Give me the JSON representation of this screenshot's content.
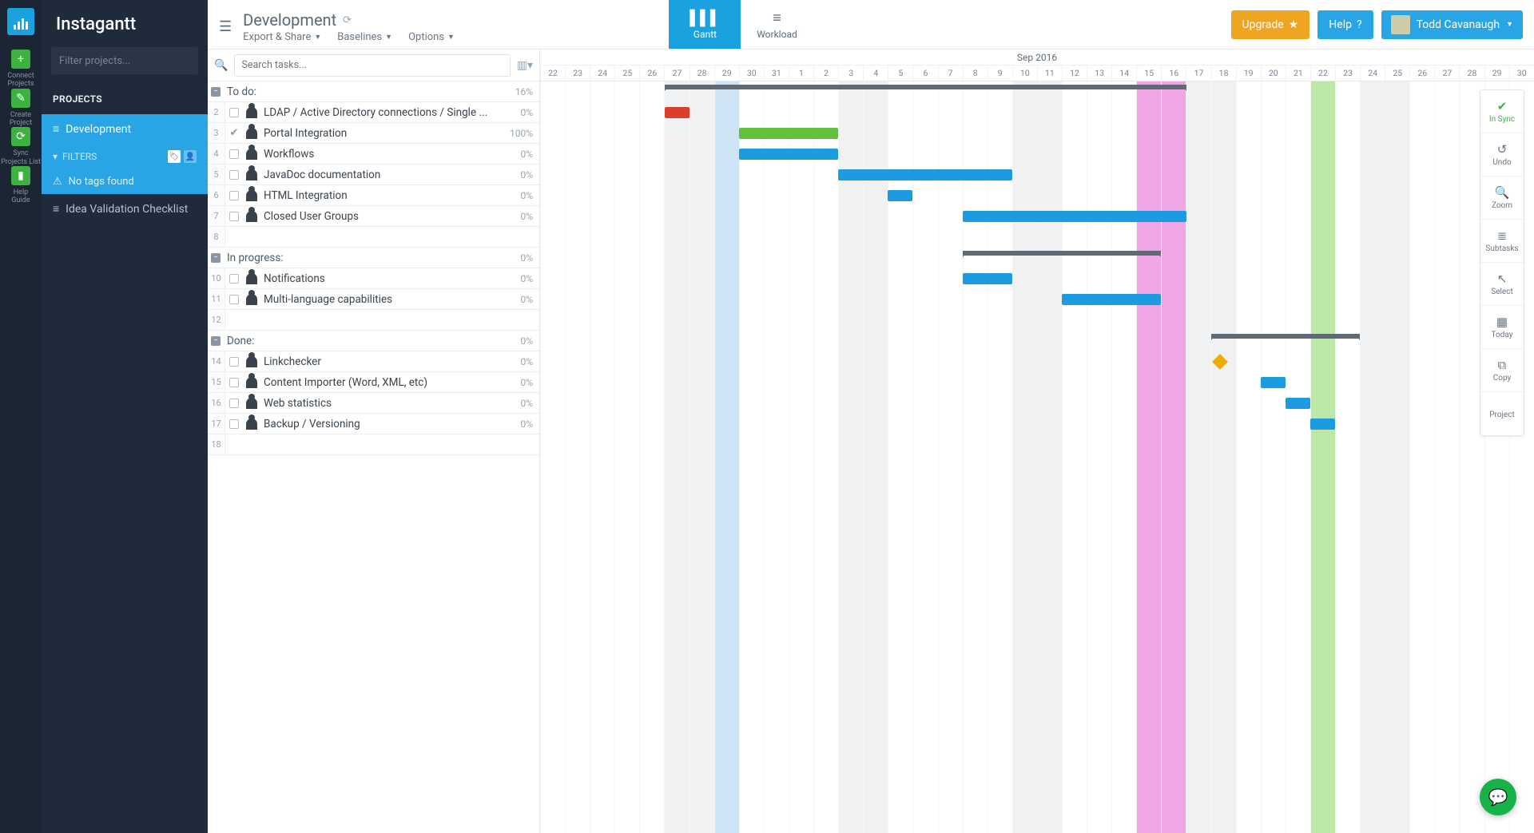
{
  "brand": "Instagantt",
  "rail": [
    {
      "icon": "+",
      "label": "Connect Projects"
    },
    {
      "icon": "✎",
      "label": "Create Project"
    },
    {
      "icon": "⟳",
      "label": "Sync Projects List"
    },
    {
      "icon": "▮",
      "label": "Help Guide"
    }
  ],
  "sidebar": {
    "filter_placeholder": "Filter projects...",
    "section": "PROJECTS",
    "projects": [
      {
        "name": "Development",
        "active": true
      },
      {
        "name": "Idea Validation Checklist",
        "active": false
      }
    ],
    "filters_label": "FILTERS",
    "no_tags": "No tags found"
  },
  "header": {
    "title": "Development",
    "menus": [
      "Export & Share",
      "Baselines",
      "Options"
    ],
    "tabs": [
      {
        "label": "Gantt",
        "active": true
      },
      {
        "label": "Workload",
        "active": false
      }
    ],
    "upgrade": "Upgrade",
    "help": "Help",
    "user": "Todd Cavanaugh"
  },
  "search_placeholder": "Search tasks...",
  "sections": [
    {
      "name": "To do:",
      "pct": "16%",
      "rows": [
        {
          "n": 2,
          "name": "LDAP / Active Directory connections / Single ...",
          "pct": "0%",
          "done": false
        },
        {
          "n": 3,
          "name": "Portal Integration",
          "pct": "100%",
          "done": true
        },
        {
          "n": 4,
          "name": "Workflows",
          "pct": "0%",
          "done": false
        },
        {
          "n": 5,
          "name": "JavaDoc documentation",
          "pct": "0%",
          "done": false
        },
        {
          "n": 6,
          "name": "HTML Integration",
          "pct": "0%",
          "done": false
        },
        {
          "n": 7,
          "name": "Closed User Groups",
          "pct": "0%",
          "done": false
        },
        {
          "n": 8,
          "name": "",
          "pct": "",
          "done": false
        }
      ]
    },
    {
      "name": "In progress:",
      "pct": "0%",
      "rows": [
        {
          "n": 10,
          "name": "Notifications",
          "pct": "0%",
          "done": false
        },
        {
          "n": 11,
          "name": "Multi-language capabilities",
          "pct": "0%",
          "done": false
        },
        {
          "n": 12,
          "name": "",
          "pct": "",
          "done": false
        }
      ]
    },
    {
      "name": "Done:",
      "pct": "0%",
      "rows": [
        {
          "n": 14,
          "name": "Linkchecker",
          "pct": "0%",
          "done": false
        },
        {
          "n": 15,
          "name": "Content Importer (Word, XML, etc)",
          "pct": "0%",
          "done": false
        },
        {
          "n": 16,
          "name": "Web statistics",
          "pct": "0%",
          "done": false
        },
        {
          "n": 17,
          "name": "Backup / Versioning",
          "pct": "0%",
          "done": false
        },
        {
          "n": 18,
          "name": "",
          "pct": "",
          "done": false
        }
      ]
    }
  ],
  "timeline": {
    "month": "Sep 2016",
    "days": [
      22,
      23,
      24,
      25,
      26,
      27,
      28,
      29,
      30,
      31,
      1,
      2,
      3,
      4,
      5,
      6,
      7,
      8,
      9,
      10,
      11,
      12,
      13,
      14,
      15,
      16,
      17,
      18,
      19,
      20,
      21,
      22,
      23,
      24,
      25,
      26,
      27,
      28,
      29,
      30
    ],
    "weekend_idx": [
      5,
      6,
      12,
      13,
      19,
      20,
      26,
      27,
      33,
      34
    ],
    "blue_idx": [
      7
    ],
    "today_idx": [
      24,
      25
    ],
    "green_idx": [
      31
    ]
  },
  "tools": [
    {
      "label": "In Sync",
      "icon": "✔",
      "cls": "sync"
    },
    {
      "label": "Undo",
      "icon": "↺"
    },
    {
      "label": "Zoom",
      "icon": "🔍"
    },
    {
      "label": "Subtasks",
      "icon": "≣"
    },
    {
      "label": "Select",
      "icon": "↖"
    },
    {
      "label": "Today",
      "icon": "▦"
    },
    {
      "label": "Copy",
      "icon": "⧉"
    },
    {
      "label": "Project",
      "icon": ""
    }
  ],
  "chart_data": {
    "type": "gantt",
    "title": "Development",
    "x_unit": "day",
    "x_range": [
      "2016-08-22",
      "2016-09-30"
    ],
    "today": "2016-09-16",
    "groups": [
      {
        "name": "To do:",
        "span": [
          "2016-08-27",
          "2016-09-16"
        ],
        "tasks": [
          {
            "name": "LDAP / Active Directory connections / Single Sign-On",
            "start": "2016-08-27",
            "end": "2016-08-28",
            "pct": 0,
            "color": "red"
          },
          {
            "name": "Portal Integration",
            "start": "2016-08-30",
            "end": "2016-09-02",
            "pct": 100,
            "color": "green"
          },
          {
            "name": "Workflows",
            "start": "2016-08-30",
            "end": "2016-09-02",
            "pct": 0,
            "color": "blue"
          },
          {
            "name": "JavaDoc documentation",
            "start": "2016-09-03",
            "end": "2016-09-09",
            "pct": 0,
            "color": "blue"
          },
          {
            "name": "HTML Integration",
            "start": "2016-09-05",
            "end": "2016-09-05",
            "pct": 0,
            "color": "blue"
          },
          {
            "name": "Closed User Groups",
            "start": "2016-09-08",
            "end": "2016-09-16",
            "pct": 0,
            "color": "blue"
          }
        ]
      },
      {
        "name": "In progress:",
        "span": [
          "2016-09-08",
          "2016-09-15"
        ],
        "tasks": [
          {
            "name": "Notifications",
            "start": "2016-09-08",
            "end": "2016-09-09",
            "pct": 0,
            "color": "blue"
          },
          {
            "name": "Multi-language capabilities",
            "start": "2016-09-12",
            "end": "2016-09-15",
            "pct": 0,
            "color": "blue"
          }
        ]
      },
      {
        "name": "Done:",
        "span": [
          "2016-09-18",
          "2016-09-22"
        ],
        "tasks": [
          {
            "name": "Linkchecker",
            "start": "2016-09-18",
            "end": "2016-09-18",
            "pct": 0,
            "milestone": true,
            "color": "orange"
          },
          {
            "name": "Content Importer (Word, XML, etc)",
            "start": "2016-09-20",
            "end": "2016-09-20",
            "pct": 0,
            "color": "blue"
          },
          {
            "name": "Web statistics",
            "start": "2016-09-21",
            "end": "2016-09-21",
            "pct": 0,
            "color": "blue"
          },
          {
            "name": "Backup / Versioning",
            "start": "2016-09-22",
            "end": "2016-09-22",
            "pct": 0,
            "color": "blue"
          }
        ]
      }
    ]
  }
}
